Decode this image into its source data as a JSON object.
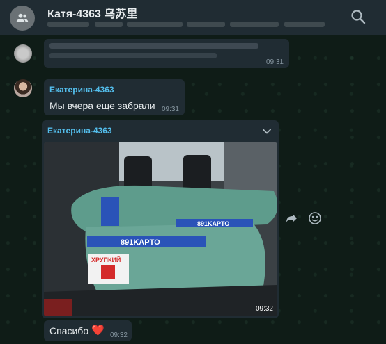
{
  "header": {
    "title": "Катя-4363 乌苏里",
    "search_icon": "search-icon",
    "group_icon": "group-avatar-icon"
  },
  "messages": [
    {
      "id": "blurred",
      "avatar": "blurred-avatar",
      "time": "09:31"
    },
    {
      "id": "m2",
      "sender": "Екатерина-4363",
      "text": "Мы вчера еще забрали",
      "time": "09:31"
    },
    {
      "id": "m3",
      "sender": "Екатерина-4363",
      "type": "image",
      "image_description": "car trunk loaded with large wrapped teal bags",
      "bag_labels": [
        "891KAPTO",
        "891KAPTO"
      ],
      "stamp_text": "ХРУПКИЙ",
      "time": "09:32"
    },
    {
      "id": "m4",
      "text": "Спасибо",
      "emoji": "❤️",
      "time": "09:32"
    }
  ],
  "colors": {
    "header_bg": "#202c33",
    "bubble_bg": "#202c33",
    "sender": "#53bdeb",
    "time": "#8696a0"
  }
}
